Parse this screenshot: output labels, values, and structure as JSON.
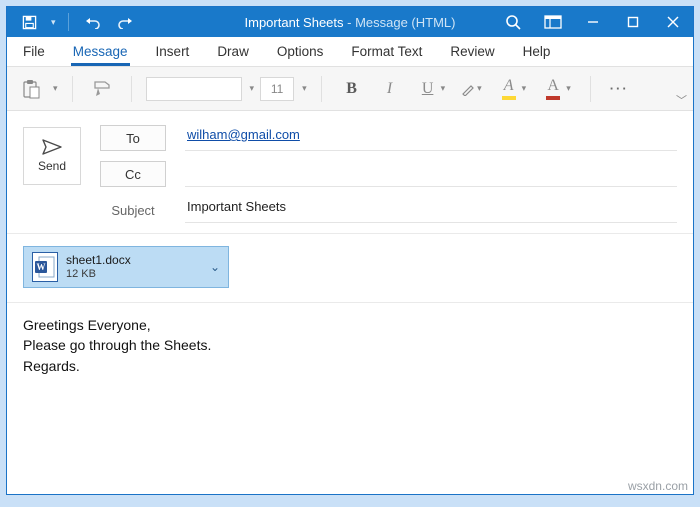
{
  "titlebar": {
    "doc_title": "Important Sheets",
    "title_suffix": "  -  Message (HTML)"
  },
  "tabs": {
    "file": "File",
    "message": "Message",
    "insert": "Insert",
    "draw": "Draw",
    "options": "Options",
    "format_text": "Format Text",
    "review": "Review",
    "help": "Help"
  },
  "ribbon": {
    "font_size": "11",
    "bold": "B",
    "italic": "I",
    "underline": "U",
    "ellipsis": "···"
  },
  "compose": {
    "send": "Send",
    "to_label": "To",
    "cc_label": "Cc",
    "subject_label": "Subject",
    "to_value": "wilham@gmail.com",
    "cc_value": "",
    "subject_value": "Important Sheets"
  },
  "attachment": {
    "name": "sheet1.docx",
    "size": "12 KB",
    "badge": "W"
  },
  "body": {
    "line1": "Greetings Everyone,",
    "line2": "Please go through the Sheets.",
    "line3": "Regards."
  },
  "watermark": "wsxdn.com"
}
